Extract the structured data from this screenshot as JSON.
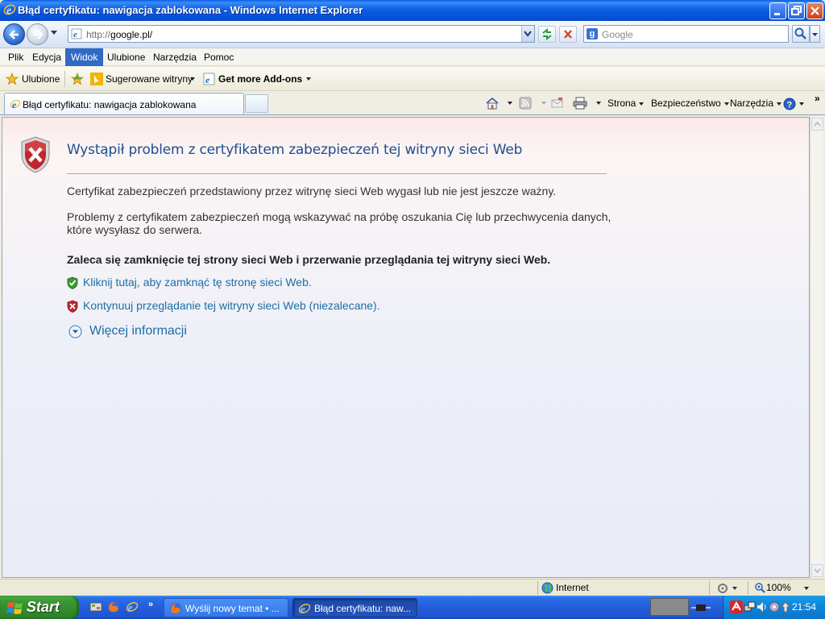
{
  "window": {
    "title": "Błąd certyfikatu: nawigacja zablokowana - Windows Internet Explorer"
  },
  "navbar": {
    "url_prefix": "http://",
    "url_host": "google.pl/",
    "search_placeholder": "Google",
    "search_engine_letter": "g"
  },
  "menu": {
    "items": [
      "Plik",
      "Edycja",
      "Widok",
      "Ulubione",
      "Narzędzia",
      "Pomoc"
    ],
    "active": "Widok"
  },
  "favorites": {
    "label": "Ulubione",
    "suggested": "Sugerowane witryny",
    "addons": "Get more Add-ons"
  },
  "tab": {
    "title": "Błąd certyfikatu: nawigacja zablokowana"
  },
  "commands": {
    "page": "Strona",
    "security": "Bezpieczeństwo",
    "tools": "Narzędzia",
    "more": "»"
  },
  "content": {
    "title": "Wystąpił problem z certyfikatem zabezpieczeń tej witryny sieci Web",
    "p1": "Certyfikat zabezpieczeń przedstawiony przez witrynę sieci Web wygasł lub nie jest jeszcze ważny.",
    "p2": "Problemy z certyfikatem zabezpieczeń mogą wskazywać na próbę oszukania Cię lub przechwycenia danych, które wysyłasz do serwera.",
    "p3": "Zaleca się zamknięcie tej strony sieci Web i przerwanie przeglądania tej witryny sieci Web.",
    "link_close": "Kliknij tutaj, aby zamknąć tę stronę sieci Web.",
    "link_continue": "Kontynuuj przeglądanie tej witryny sieci Web (niezalecane).",
    "more_info": "Więcej informacji"
  },
  "status": {
    "zone": "Internet",
    "zoom": "100%"
  },
  "taskbar": {
    "start": "Start",
    "tasks": [
      "Wyślij nowy temat • ...",
      "Błąd certyfikatu: naw..."
    ],
    "clock": "21:54"
  },
  "colors": {
    "link": "#1c6ea4",
    "title": "#1f4e8c",
    "error_red": "#c0262c",
    "ok_green": "#3b9a2e"
  }
}
